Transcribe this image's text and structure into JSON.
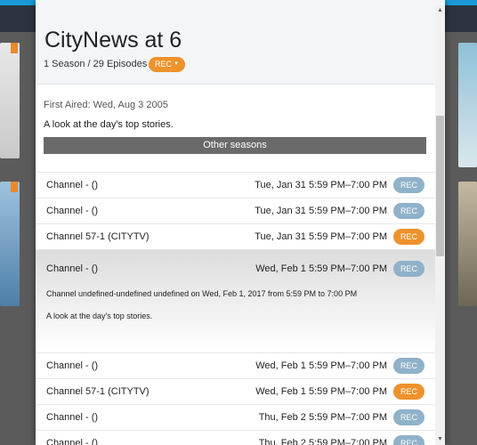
{
  "show": {
    "title": "CityNews at 6",
    "subtitle": "1 Season / 29 Episodes",
    "rec_label": "REC",
    "first_aired": "First Aired: Wed, Aug 3 2005",
    "description": "A look at the day's top stories.",
    "other_seasons_label": "Other seasons"
  },
  "airings": [
    {
      "channel": "Channel - ()",
      "when": "Tue, Jan 31  5:59 PM–7:00 PM",
      "rec": "REC",
      "recording": false
    },
    {
      "channel": "Channel - ()",
      "when": "Tue, Jan 31  5:59 PM–7:00 PM",
      "rec": "REC",
      "recording": false
    },
    {
      "channel": "Channel 57-1 (CITYTV)",
      "when": "Tue, Jan 31  5:59 PM–7:00 PM",
      "rec": "REC",
      "recording": true
    },
    {
      "channel": "Channel - ()",
      "when": "Wed, Feb 1  5:59 PM–7:00 PM",
      "rec": "REC",
      "recording": false,
      "detail": "Channel undefined-undefined undefined on Wed, Feb 1, 2017 from 5:59 PM to 7:00 PM",
      "detail_desc": "A look at the day's top stories."
    },
    {
      "channel": "Channel - ()",
      "when": "Wed, Feb 1  5:59 PM–7:00 PM",
      "rec": "REC",
      "recording": false
    },
    {
      "channel": "Channel 57-1 (CITYTV)",
      "when": "Wed, Feb 1  5:59 PM–7:00 PM",
      "rec": "REC",
      "recording": true
    },
    {
      "channel": "Channel - ()",
      "when": "Thu, Feb 2  5:59 PM–7:00 PM",
      "rec": "REC",
      "recording": false
    },
    {
      "channel": "Channel - ()",
      "when": "Thu, Feb 2  5:59 PM–7:00 PM",
      "rec": "REC",
      "recording": false
    }
  ],
  "colors": {
    "rec_on": "#ee922c",
    "rec_off": "#8fb2c9",
    "accent_top": "#1a9bd7"
  }
}
